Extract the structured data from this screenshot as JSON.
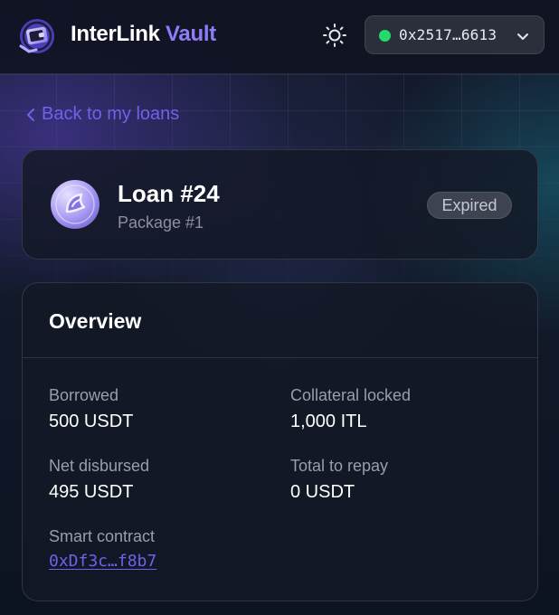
{
  "header": {
    "brand_part1": "InterLink",
    "brand_part2": "Vault",
    "wallet_address": "0x2517…6613",
    "wallet_status_color": "#25d96a"
  },
  "nav": {
    "back_label": "Back to my loans"
  },
  "loan": {
    "title": "Loan #24",
    "package": "Package #1",
    "status": "Expired"
  },
  "overview": {
    "title": "Overview",
    "borrowed_label": "Borrowed",
    "borrowed_value": "500 USDT",
    "collateral_label": "Collateral locked",
    "collateral_value": "1,000 ITL",
    "net_disbursed_label": "Net disbursed",
    "net_disbursed_value": "495 USDT",
    "total_repay_label": "Total to repay",
    "total_repay_value": "0 USDT",
    "contract_label": "Smart contract",
    "contract_address": "0xDf3c…f8b7"
  },
  "colors": {
    "accent": "#8e7cf8",
    "link": "#6f62e8"
  },
  "icons": {
    "logo": "wallet-logo-icon",
    "theme": "sun-icon",
    "chevron": "chevron-down-icon",
    "back": "chevron-left-icon",
    "loan_token": "token-coin-icon"
  }
}
